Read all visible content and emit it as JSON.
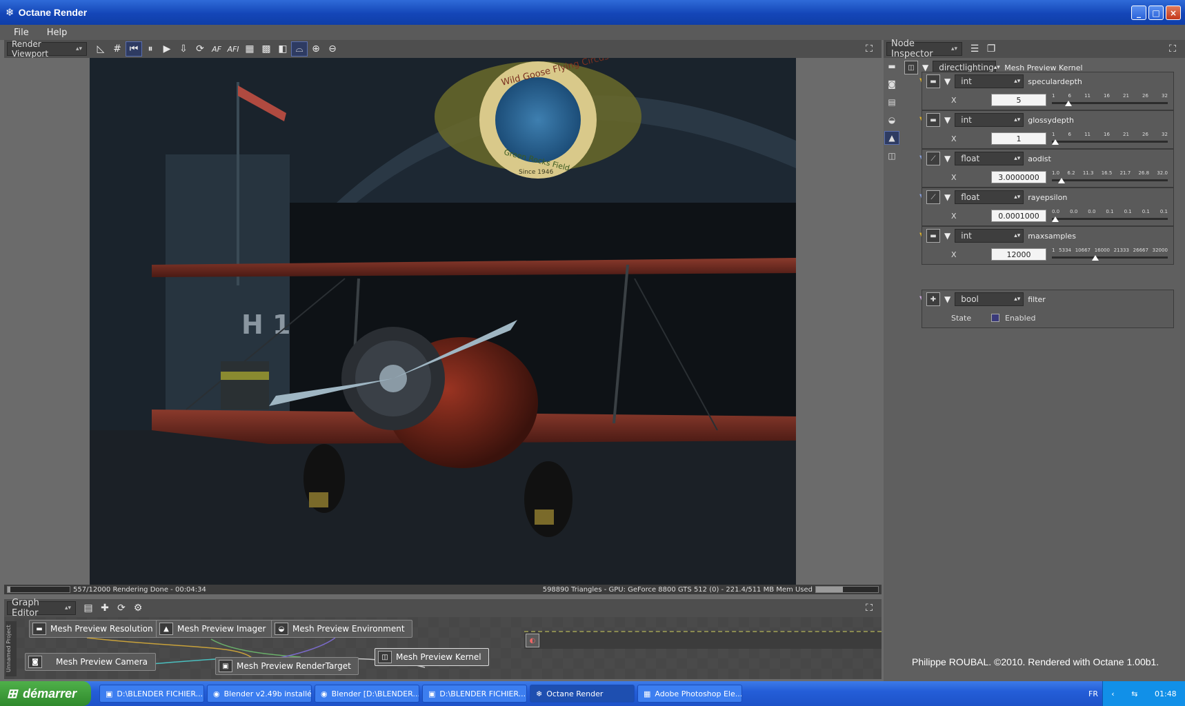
{
  "window": {
    "title": "Octane Render",
    "minimize": "_",
    "maximize": "□",
    "close": "×"
  },
  "menu": [
    "File",
    "Help"
  ],
  "render_toolbar": {
    "mode": "Render Viewport",
    "af_label": "AF",
    "afi_label": "AFI"
  },
  "status": {
    "left": "557/12000 Rendering Done - 00:04:34",
    "right": "598890 Triangles - GPU: GeForce 8800 GTS 512 (0) - 221.4/511 MB Mem Used",
    "progress": 0.046,
    "mem": 0.43
  },
  "graph_editor": {
    "title": "Graph Editor",
    "project_label": "Unnamed Project",
    "nodes": [
      "Mesh Preview Resolution",
      "Mesh Preview Imager",
      "Mesh Preview Environment",
      "Mesh Preview Camera",
      "Mesh Preview RenderTarget",
      "Mesh Preview Kernel"
    ]
  },
  "inspector": {
    "title": "Node Inspector",
    "kernel_type": "directlighting",
    "kernel_name": "Mesh Preview Kernel",
    "params": [
      {
        "type": "int",
        "name": "speculardepth",
        "axis": "X",
        "value": "5",
        "ticks": [
          "1",
          "6",
          "11",
          "16",
          "21",
          "26",
          "32"
        ],
        "pos": 0.12
      },
      {
        "type": "int",
        "name": "glossydepth",
        "axis": "X",
        "value": "1",
        "ticks": [
          "1",
          "6",
          "11",
          "16",
          "21",
          "26",
          "32"
        ],
        "pos": 0.0
      },
      {
        "type": "float",
        "name": "aodist",
        "axis": "X",
        "value": "3.0000000",
        "ticks": [
          "1.0",
          "6.2",
          "11.3",
          "16.5",
          "21.7",
          "26.8",
          "32.0"
        ],
        "pos": 0.06
      },
      {
        "type": "float",
        "name": "rayepsilon",
        "axis": "X",
        "value": "0.0001000",
        "ticks": [
          "0.0",
          "0.0",
          "0.0",
          "0.1",
          "0.1",
          "0.1",
          "0.1"
        ],
        "pos": 0.0
      },
      {
        "type": "int",
        "name": "maxsamples",
        "axis": "X",
        "value": "12000",
        "ticks": [
          "1",
          "5334",
          "10667",
          "16000",
          "21333",
          "26667",
          "32000"
        ],
        "pos": 0.37
      }
    ],
    "bool_param": {
      "type": "bool",
      "name": "filter",
      "state_label": "State",
      "checkbox_label": "Enabled"
    }
  },
  "credit": "Philippe ROUBAL. ©2010. Rendered with Octane 1.00b1.",
  "taskbar": {
    "start": "démarrer",
    "tasks": [
      "D:\\BLENDER FICHIER...",
      "Blender v2.49b installé",
      "Blender [D:\\BLENDER...",
      "D:\\BLENDER FICHIER...",
      "Octane Render",
      "Adobe Photoshop Ele..."
    ],
    "lang": "FR",
    "clock": "01:48"
  },
  "render_image": {
    "hangar_sign": "H 1",
    "emblem_top": "Wild Goose Flying Circus",
    "emblem_bottom": "Green Rocks Field",
    "emblem_since": "Since 1946"
  }
}
